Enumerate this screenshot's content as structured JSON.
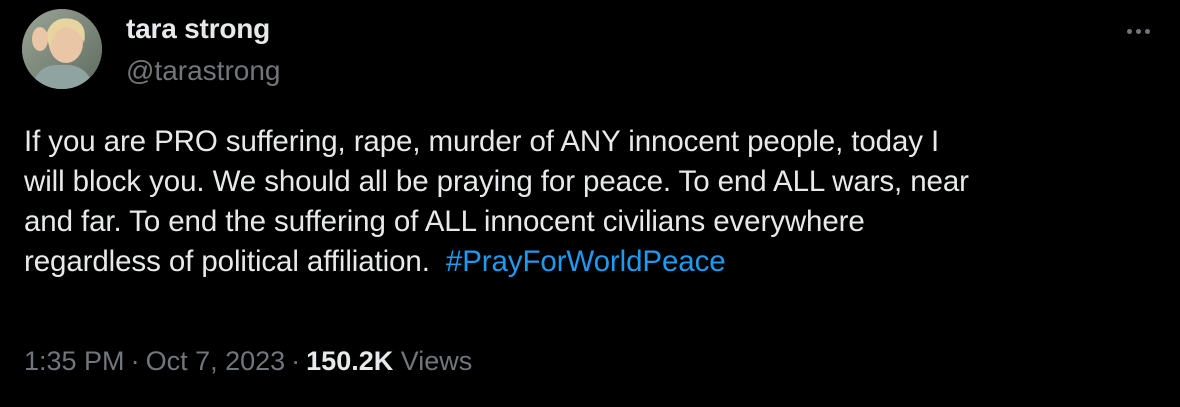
{
  "author": {
    "display_name": "tara strong",
    "handle": "@tarastrong"
  },
  "tweet": {
    "text_lines": [
      "If you are PRO suffering, rape, murder of ANY innocent people, today I",
      "will block you. We should all be praying for peace. To end ALL wars, near",
      "and far. To end the suffering of ALL innocent civilians everywhere",
      "regardless of political affiliation. "
    ],
    "hashtag": "#PrayForWorldPeace"
  },
  "meta": {
    "time": "1:35 PM",
    "separator": "·",
    "date": "Oct 7, 2023",
    "views_count": "150.2K",
    "views_label": "Views"
  },
  "icons": {
    "more": "more-horizontal-icon"
  },
  "colors": {
    "background": "#000000",
    "text": "#e7e9ea",
    "secondary": "#71767b",
    "link": "#1d9bf0"
  }
}
